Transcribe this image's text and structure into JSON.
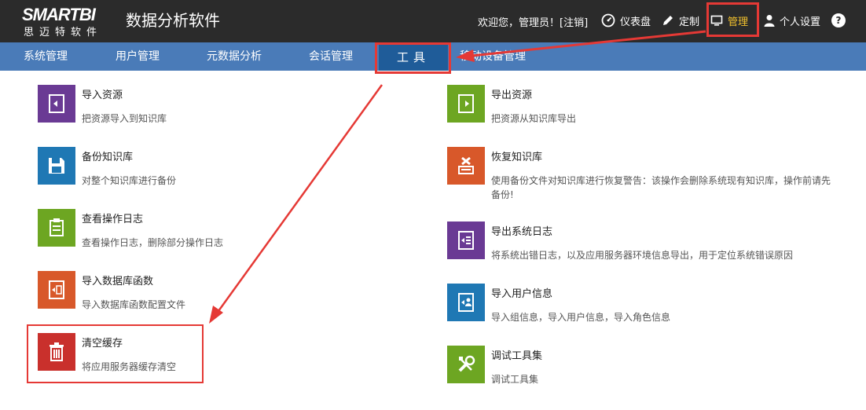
{
  "header": {
    "logo_text": "SMARTBI",
    "logo_sub": "思迈特软件",
    "app_title": "数据分析软件",
    "welcome": "欢迎您，管理员！[",
    "logout": "注销",
    "welcome_end": "]",
    "nav": {
      "dashboard": "仪表盘",
      "customize": "定制",
      "manage": "管理",
      "user_settings": "个人设置",
      "help": "?"
    }
  },
  "menubar": {
    "items": [
      "系统管理",
      "用户管理",
      "元数据分析",
      "会话管理",
      "工具",
      "移动设备管理"
    ]
  },
  "tools": {
    "left": [
      {
        "title": "导入资源",
        "desc": "把资源导入到知识库",
        "color": "#6a3a94",
        "icon": "import-book-icon"
      },
      {
        "title": "备份知识库",
        "desc": "对整个知识库进行备份",
        "color": "#1f78b4",
        "icon": "floppy-disk-icon"
      },
      {
        "title": "查看操作日志",
        "desc": "查看操作日志，删除部分操作日志",
        "color": "#6da622",
        "icon": "clipboard-icon"
      },
      {
        "title": "导入数据库函数",
        "desc": "导入数据库函数配置文件",
        "color": "#d8582a",
        "icon": "function-book-icon"
      },
      {
        "title": "清空缓存",
        "desc": "将应用服务器缓存清空",
        "color": "#c9302c",
        "icon": "trash-icon"
      }
    ],
    "right": [
      {
        "title": "导出资源",
        "desc": "把资源从知识库导出",
        "color": "#6da622",
        "icon": "export-book-icon"
      },
      {
        "title": "恢复知识库",
        "desc": "使用备份文件对知识库进行恢复警告：该操作会删除系统现有知识库，操作前请先备份!",
        "color": "#d8582a",
        "icon": "restore-icon"
      },
      {
        "title": "导出系统日志",
        "desc": "将系统出错日志，以及应用服务器环境信息导出，用于定位系统错误原因",
        "color": "#6a3a94",
        "icon": "log-book-icon"
      },
      {
        "title": "导入用户信息",
        "desc": "导入组信息，导入用户信息，导入角色信息",
        "color": "#1f78b4",
        "icon": "user-book-icon"
      },
      {
        "title": "调试工具集",
        "desc": "调试工具集",
        "color": "#6da622",
        "icon": "tools-icon"
      }
    ]
  },
  "colors": {
    "header_bg": "#2b2b2b",
    "menubar_bg": "#4a7bb8",
    "active_tab_bg": "#1f5c99",
    "highlight": "#e53935",
    "manage_active": "#f2c12e"
  }
}
